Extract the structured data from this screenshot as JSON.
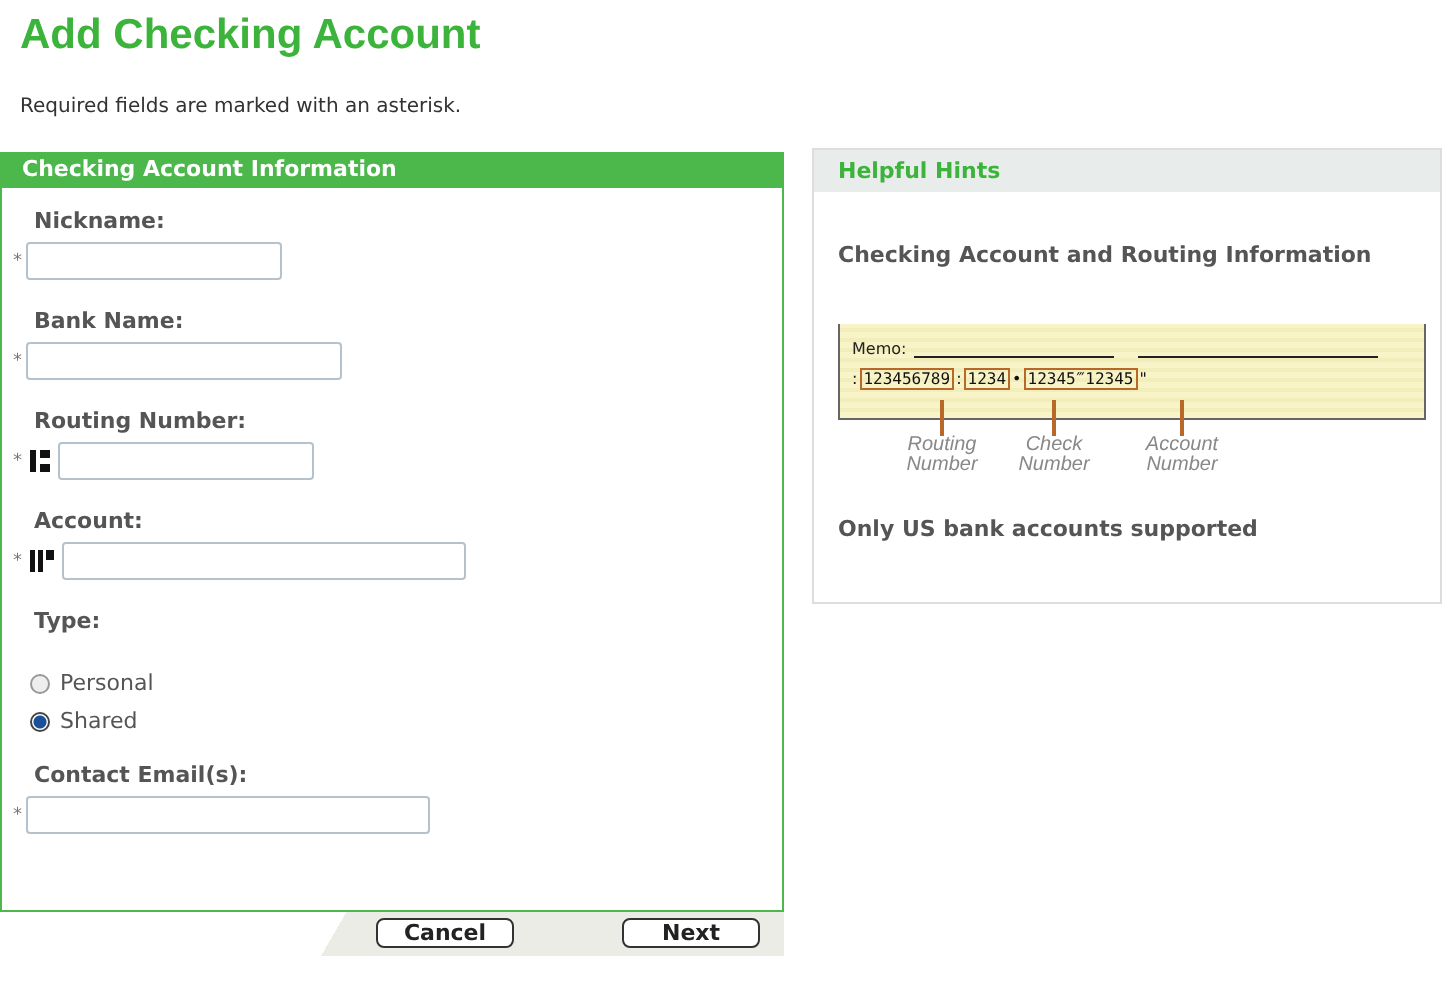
{
  "title": "Add Checking Account",
  "note": "Required fields are marked with an asterisk.",
  "form": {
    "header": "Checking Account Information",
    "fields": [
      {
        "kind": "text",
        "label": "Nickname:",
        "required_mark": "*"
      },
      {
        "kind": "text",
        "label": "Bank Name:",
        "required_mark": "*"
      },
      {
        "kind": "routing",
        "label": "Routing Number:",
        "required_mark": "*"
      },
      {
        "kind": "account",
        "label": "Account:",
        "required_mark": "*"
      },
      {
        "kind": "radio",
        "label": "Type:",
        "options": [
          {
            "label": "Personal",
            "selected": false
          },
          {
            "label": "Shared",
            "selected": true
          }
        ]
      },
      {
        "kind": "text",
        "label": "Contact Email(s):",
        "required_mark": "*"
      }
    ]
  },
  "buttons": [
    "Cancel",
    "Next"
  ],
  "hints": {
    "header": "Helpful Hints",
    "heading": "Checking Account and Routing Information",
    "check": {
      "memo": "Memo:",
      "lead": ":",
      "segments": [
        {
          "number": "123456789",
          "separator": ":",
          "label": "Routing Number"
        },
        {
          "number": "1234",
          "separator": "•",
          "label": "Check Number"
        },
        {
          "number": "12345‴12345",
          "separator": "\"",
          "label": "Account Number"
        }
      ]
    },
    "footer": "Only US bank accounts supported"
  }
}
